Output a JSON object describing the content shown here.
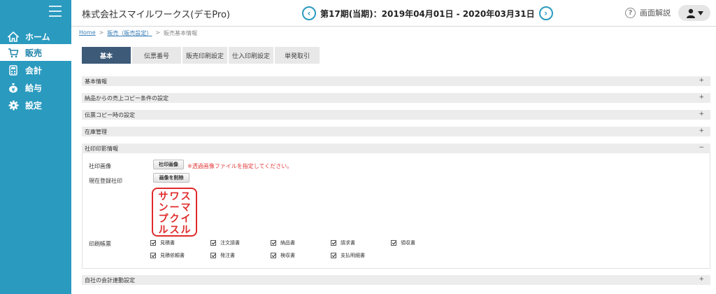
{
  "sidebar": {
    "items": [
      {
        "label": "ホーム",
        "icon": "home-icon"
      },
      {
        "label": "販売",
        "icon": "cart-icon"
      },
      {
        "label": "会計",
        "icon": "calculator-icon"
      },
      {
        "label": "給与",
        "icon": "money-bag-icon"
      },
      {
        "label": "設定",
        "icon": "gear-icon"
      }
    ],
    "active_index": 1,
    "bg_color": "#2a9abf"
  },
  "header": {
    "company": "株式会社スマイルワークス(デモPro)",
    "period": "第17期(当期)：2019年04月01日 - 2020年03月31日",
    "help_label": "画面解説",
    "prev_symbol": "‹",
    "next_symbol": "›"
  },
  "breadcrumb": {
    "home": "Home",
    "sep": ">",
    "sales": "販売（販売設定）",
    "current": "販売基本情報"
  },
  "tabs": [
    "基本",
    "伝票番号",
    "販売印刷設定",
    "仕入印刷設定",
    "単発取引"
  ],
  "sections": {
    "basic_info": "基本情報",
    "delivery_copy": "納品からの売上コピー条件の設定",
    "slip_copy": "伝票コピー時の設定",
    "inventory": "在庫管理",
    "seal_print": "社印印影情報",
    "accounting": "自社の会計連動設定",
    "plus": "+",
    "minus": "−"
  },
  "seal_panel": {
    "seal_image_label": "社印画像",
    "seal_image_button": "社印画像",
    "error_message": "※透過画像ファイルを指定してください。",
    "current_seal_label": "現在登録社印",
    "delete_button": "画像を削除",
    "seal_columns": [
      "スマイル",
      "ワークス",
      "サンプル"
    ],
    "print_docs_label": "印刷帳票",
    "print_docs": [
      "見積書",
      "注文請書",
      "納品書",
      "請求書",
      "領収書",
      "見積依頼書",
      "発注書",
      "検収書",
      "支払明細書"
    ]
  }
}
